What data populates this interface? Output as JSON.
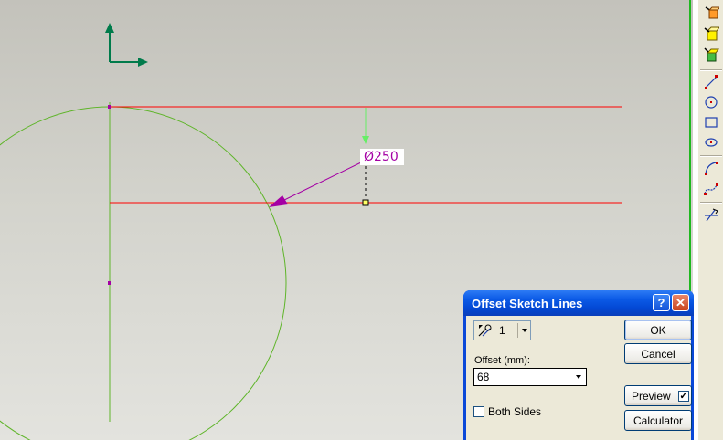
{
  "sketch": {
    "dimension_label": "Ø250"
  },
  "toolbar": {
    "tools": [
      {
        "name": "sketch-on-face-icon"
      },
      {
        "name": "sketch-plane-icon"
      },
      {
        "name": "sketch-view-icon"
      },
      {
        "name": "line-tool-icon"
      },
      {
        "name": "circle-tool-icon"
      },
      {
        "name": "rectangle-tool-icon"
      },
      {
        "name": "ellipse-tool-icon"
      },
      {
        "name": "arc-tool-icon"
      },
      {
        "name": "spline-tool-icon"
      },
      {
        "name": "trim-tool-icon"
      }
    ]
  },
  "dialog": {
    "title": "Offset Sketch Lines",
    "help_label": "?",
    "close_label": "✕",
    "count_value": "1",
    "offset_label": "Offset (mm):",
    "offset_value": "68",
    "both_sides_label": "Both Sides",
    "both_sides_checked": false,
    "ok_label": "OK",
    "cancel_label": "Cancel",
    "preview_label": "Preview",
    "preview_checked": true,
    "calculator_label": "Calculator"
  },
  "colors": {
    "construction_line": "#ff0000",
    "sketch_geometry": "#5fb52a",
    "dimension": "#a400a4",
    "axis": "#007b4b"
  }
}
